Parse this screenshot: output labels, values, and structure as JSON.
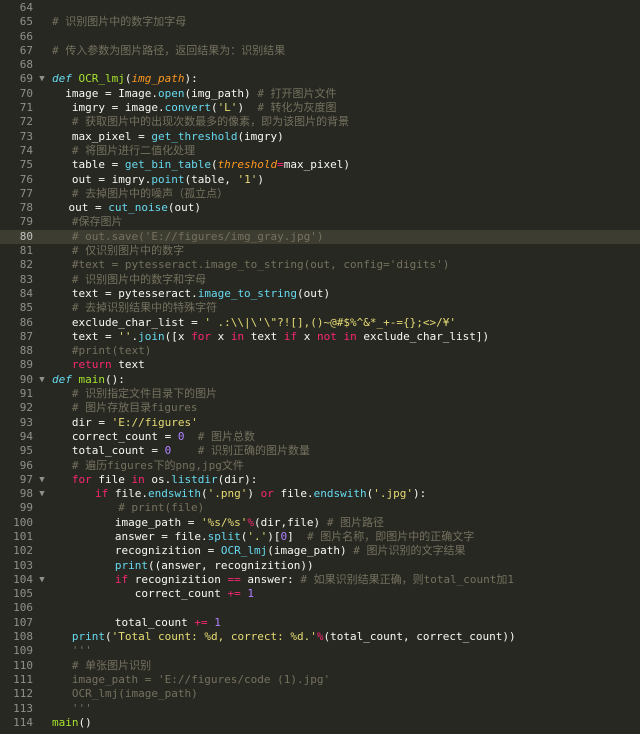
{
  "editor": {
    "active_line": 80,
    "fold_marker": "▼",
    "lines": [
      {
        "n": "64",
        "indent": 0,
        "tokens": []
      },
      {
        "n": "65",
        "indent": 0,
        "tokens": [
          [
            "comment",
            "# 识别图片中的数字加字母"
          ]
        ]
      },
      {
        "n": "66",
        "indent": 0,
        "tokens": []
      },
      {
        "n": "67",
        "indent": 0,
        "tokens": [
          [
            "comment",
            "# 传入参数为图片路径，返回结果为：识别结果"
          ]
        ]
      },
      {
        "n": "68",
        "indent": 0,
        "tokens": []
      },
      {
        "n": "69",
        "indent": 0,
        "fold": true,
        "tokens": [
          [
            "storage",
            "def "
          ],
          [
            "func",
            "OCR_lmj"
          ],
          [
            "plain",
            "("
          ],
          [
            "param",
            "img_path"
          ],
          [
            "plain",
            "):"
          ]
        ]
      },
      {
        "n": "70",
        "indent": 2,
        "tokens": [
          [
            "plain",
            "image = Image."
          ],
          [
            "builtin",
            "open"
          ],
          [
            "plain",
            "(img_path) "
          ],
          [
            "comment",
            "# 打开图片文件"
          ]
        ]
      },
      {
        "n": "71",
        "indent": 3,
        "tokens": [
          [
            "plain",
            "imgry = image."
          ],
          [
            "builtin",
            "convert"
          ],
          [
            "plain",
            "("
          ],
          [
            "string",
            "'L'"
          ],
          [
            "plain",
            ")  "
          ],
          [
            "comment",
            "# 转化为灰度图"
          ]
        ]
      },
      {
        "n": "72",
        "indent": 3,
        "tokens": [
          [
            "comment",
            "# 获取图片中的出现次数最多的像素，即为该图片的背景"
          ]
        ]
      },
      {
        "n": "73",
        "indent": 3,
        "tokens": [
          [
            "plain",
            "max_pixel = "
          ],
          [
            "builtin",
            "get_threshold"
          ],
          [
            "plain",
            "(imgry)"
          ]
        ]
      },
      {
        "n": "74",
        "indent": 3,
        "tokens": [
          [
            "comment",
            "# 将图片进行二值化处理"
          ]
        ]
      },
      {
        "n": "75",
        "indent": 3,
        "tokens": [
          [
            "plain",
            "table = "
          ],
          [
            "builtin",
            "get_bin_table"
          ],
          [
            "plain",
            "("
          ],
          [
            "param",
            "threshold"
          ],
          [
            "keyword",
            "="
          ],
          [
            "plain",
            "max_pixel)"
          ]
        ]
      },
      {
        "n": "76",
        "indent": 3,
        "tokens": [
          [
            "plain",
            "out = imgry."
          ],
          [
            "builtin",
            "point"
          ],
          [
            "plain",
            "(table, "
          ],
          [
            "string",
            "'1'"
          ],
          [
            "plain",
            ")"
          ]
        ]
      },
      {
        "n": "77",
        "indent": 3,
        "tokens": [
          [
            "comment",
            "# 去掉图片中的噪声（孤立点）"
          ]
        ]
      },
      {
        "n": "78",
        "indent": 2.5,
        "tokens": [
          [
            "plain",
            "out = "
          ],
          [
            "builtin",
            "cut_noise"
          ],
          [
            "plain",
            "(out)"
          ]
        ]
      },
      {
        "n": "79",
        "indent": 3,
        "tokens": [
          [
            "comment",
            "#保存图片"
          ]
        ]
      },
      {
        "n": "80",
        "indent": 3,
        "tokens": [
          [
            "comment",
            "# out.save('E://figures/img_gray.jpg')"
          ]
        ]
      },
      {
        "n": "81",
        "indent": 3,
        "tokens": [
          [
            "comment",
            "# 仅识别图片中的数字"
          ]
        ]
      },
      {
        "n": "82",
        "indent": 3,
        "tokens": [
          [
            "comment",
            "#text = pytesseract.image_to_string(out, config='digits')"
          ]
        ]
      },
      {
        "n": "83",
        "indent": 3,
        "tokens": [
          [
            "comment",
            "# 识别图片中的数字和字母"
          ]
        ]
      },
      {
        "n": "84",
        "indent": 3,
        "tokens": [
          [
            "plain",
            "text = pytesseract."
          ],
          [
            "builtin",
            "image_to_string"
          ],
          [
            "plain",
            "(out)"
          ]
        ]
      },
      {
        "n": "85",
        "indent": 3,
        "tokens": [
          [
            "comment",
            "# 去掉识别结果中的特殊字符"
          ]
        ]
      },
      {
        "n": "86",
        "indent": 3,
        "tokens": [
          [
            "plain",
            "exclude_char_list = "
          ],
          [
            "string",
            "' .:\\\\|\\'\\\"?![],()~@#$%^&*_+-={};<>/¥'"
          ]
        ]
      },
      {
        "n": "87",
        "indent": 3,
        "tokens": [
          [
            "plain",
            "text = "
          ],
          [
            "string",
            "''"
          ],
          [
            "plain",
            "."
          ],
          [
            "builtin",
            "join"
          ],
          [
            "plain",
            "([x "
          ],
          [
            "keyword",
            "for"
          ],
          [
            "plain",
            " x "
          ],
          [
            "keyword",
            "in"
          ],
          [
            "plain",
            " text "
          ],
          [
            "keyword",
            "if"
          ],
          [
            "plain",
            " x "
          ],
          [
            "keyword",
            "not in"
          ],
          [
            "plain",
            " exclude_char_list])"
          ]
        ]
      },
      {
        "n": "88",
        "indent": 3,
        "tokens": [
          [
            "comment",
            "#print(text)"
          ]
        ]
      },
      {
        "n": "89",
        "indent": 3,
        "tokens": [
          [
            "keyword",
            "return"
          ],
          [
            "plain",
            " text"
          ]
        ]
      },
      {
        "n": "90",
        "indent": 0,
        "fold": true,
        "tokens": [
          [
            "storage",
            "def "
          ],
          [
            "func",
            "main"
          ],
          [
            "plain",
            "():"
          ]
        ]
      },
      {
        "n": "91",
        "indent": 3,
        "tokens": [
          [
            "comment",
            "# 识别指定文件目录下的图片"
          ]
        ]
      },
      {
        "n": "92",
        "indent": 3,
        "tokens": [
          [
            "comment",
            "# 图片存放目录figures"
          ]
        ]
      },
      {
        "n": "93",
        "indent": 3,
        "tokens": [
          [
            "plain",
            "dir = "
          ],
          [
            "string",
            "'E://figures'"
          ]
        ]
      },
      {
        "n": "94",
        "indent": 3,
        "tokens": [
          [
            "plain",
            "correct_count = "
          ],
          [
            "number",
            "0"
          ],
          [
            "plain",
            "  "
          ],
          [
            "comment",
            "# 图片总数"
          ]
        ]
      },
      {
        "n": "95",
        "indent": 3,
        "tokens": [
          [
            "plain",
            "total_count = "
          ],
          [
            "number",
            "0"
          ],
          [
            "plain",
            "    "
          ],
          [
            "comment",
            "# 识别正确的图片数量"
          ]
        ]
      },
      {
        "n": "96",
        "indent": 3,
        "tokens": [
          [
            "comment",
            "# 遍历figures下的png,jpg文件"
          ]
        ]
      },
      {
        "n": "97",
        "indent": 3,
        "fold": true,
        "tokens": [
          [
            "keyword",
            "for"
          ],
          [
            "plain",
            " file "
          ],
          [
            "keyword",
            "in"
          ],
          [
            "plain",
            " os."
          ],
          [
            "builtin",
            "listdir"
          ],
          [
            "plain",
            "(dir):"
          ]
        ]
      },
      {
        "n": "98",
        "indent": 6.5,
        "fold": true,
        "tokens": [
          [
            "keyword",
            "if"
          ],
          [
            "plain",
            " file."
          ],
          [
            "builtin",
            "endswith"
          ],
          [
            "plain",
            "("
          ],
          [
            "string",
            "'.png'"
          ],
          [
            "plain",
            ") "
          ],
          [
            "keyword",
            "or"
          ],
          [
            "plain",
            " file."
          ],
          [
            "builtin",
            "endswith"
          ],
          [
            "plain",
            "("
          ],
          [
            "string",
            "'.jpg'"
          ],
          [
            "plain",
            "):"
          ]
        ]
      },
      {
        "n": "99",
        "indent": 10,
        "tokens": [
          [
            "comment",
            "# print(file)"
          ]
        ]
      },
      {
        "n": "100",
        "indent": 9.5,
        "tokens": [
          [
            "plain",
            "image_path = "
          ],
          [
            "string",
            "'%s/%s'"
          ],
          [
            "keyword",
            "%"
          ],
          [
            "plain",
            "(dir,file) "
          ],
          [
            "comment",
            "# 图片路径"
          ]
        ]
      },
      {
        "n": "101",
        "indent": 9.5,
        "tokens": [
          [
            "plain",
            "answer = file."
          ],
          [
            "builtin",
            "split"
          ],
          [
            "plain",
            "("
          ],
          [
            "string",
            "'.'"
          ],
          [
            "plain",
            ")["
          ],
          [
            "number",
            "0"
          ],
          [
            "plain",
            "]  "
          ],
          [
            "comment",
            "# 图片名称，即图片中的正确文字"
          ]
        ]
      },
      {
        "n": "102",
        "indent": 9.5,
        "tokens": [
          [
            "plain",
            "recognizition = "
          ],
          [
            "builtin",
            "OCR_lmj"
          ],
          [
            "plain",
            "(image_path) "
          ],
          [
            "comment",
            "# 图片识别的文字结果"
          ]
        ]
      },
      {
        "n": "103",
        "indent": 9.5,
        "tokens": [
          [
            "builtin",
            "print"
          ],
          [
            "plain",
            "((answer, recognizition))"
          ]
        ]
      },
      {
        "n": "104",
        "indent": 9.5,
        "fold": true,
        "tokens": [
          [
            "keyword",
            "if"
          ],
          [
            "plain",
            " recognizition "
          ],
          [
            "keyword",
            "=="
          ],
          [
            "plain",
            " answer: "
          ],
          [
            "comment",
            "# 如果识别结果正确，则total_count加1"
          ]
        ]
      },
      {
        "n": "105",
        "indent": 12.5,
        "tokens": [
          [
            "plain",
            "correct_count "
          ],
          [
            "keyword",
            "+="
          ],
          [
            "plain",
            " "
          ],
          [
            "number",
            "1"
          ]
        ]
      },
      {
        "n": "106",
        "indent": 0,
        "tokens": []
      },
      {
        "n": "107",
        "indent": 9.5,
        "tokens": [
          [
            "plain",
            "total_count "
          ],
          [
            "keyword",
            "+="
          ],
          [
            "plain",
            " "
          ],
          [
            "number",
            "1"
          ]
        ]
      },
      {
        "n": "108",
        "indent": 3,
        "tokens": [
          [
            "builtin",
            "print"
          ],
          [
            "plain",
            "("
          ],
          [
            "string",
            "'Total count: %d, correct: %d.'"
          ],
          [
            "keyword",
            "%"
          ],
          [
            "plain",
            "(total_count, correct_count))"
          ]
        ]
      },
      {
        "n": "109",
        "indent": 3,
        "tokens": [
          [
            "comment",
            "'''"
          ]
        ]
      },
      {
        "n": "110",
        "indent": 3,
        "tokens": [
          [
            "comment",
            "# 单张图片识别"
          ]
        ]
      },
      {
        "n": "111",
        "indent": 3,
        "tokens": [
          [
            "comment",
            "image_path = 'E://figures/code (1).jpg'"
          ]
        ]
      },
      {
        "n": "112",
        "indent": 3,
        "tokens": [
          [
            "comment",
            "OCR_lmj(image_path)"
          ]
        ]
      },
      {
        "n": "113",
        "indent": 3,
        "tokens": [
          [
            "comment",
            "'''"
          ]
        ]
      },
      {
        "n": "114",
        "indent": 0,
        "tokens": [
          [
            "func",
            "main"
          ],
          [
            "plain",
            "()"
          ]
        ]
      }
    ]
  }
}
